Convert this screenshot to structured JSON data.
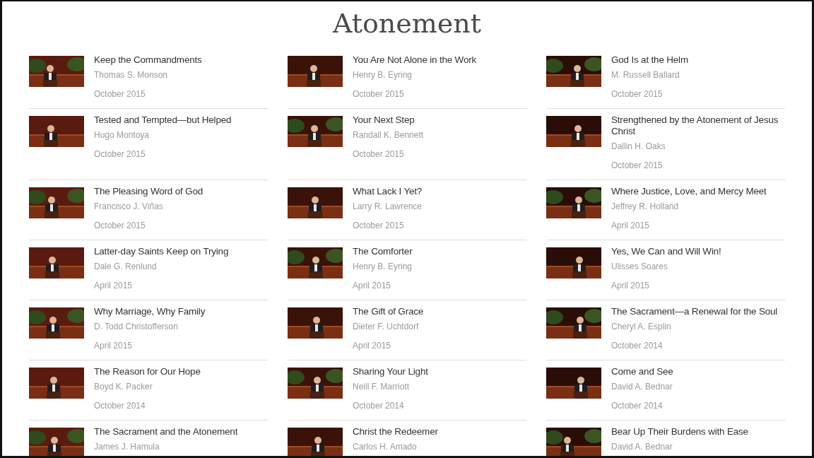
{
  "page": {
    "title": "Atonement"
  },
  "talks": [
    {
      "title": "Keep the Commandments",
      "speaker": "Thomas S. Monson",
      "date": "October 2015"
    },
    {
      "title": "You Are Not Alone in the Work",
      "speaker": "Henry B. Eyring",
      "date": "October 2015"
    },
    {
      "title": "God Is at the Helm",
      "speaker": "M. Russell Ballard",
      "date": "October 2015"
    },
    {
      "title": "Tested and Tempted—but Helped",
      "speaker": "Hugo Montoya",
      "date": "October 2015"
    },
    {
      "title": "Your Next Step",
      "speaker": "Randall K. Bennett",
      "date": "October 2015"
    },
    {
      "title": "Strengthened by the Atonement of Jesus Christ",
      "speaker": "Dallin H. Oaks",
      "date": "October 2015"
    },
    {
      "title": "The Pleasing Word of God",
      "speaker": "Francisco J. Viñas",
      "date": "October 2015"
    },
    {
      "title": "What Lack I Yet?",
      "speaker": "Larry R. Lawrence",
      "date": "October 2015"
    },
    {
      "title": "Where Justice, Love, and Mercy Meet",
      "speaker": "Jeffrey R. Holland",
      "date": "April 2015"
    },
    {
      "title": "Latter-day Saints Keep on Trying",
      "speaker": "Dale G. Renlund",
      "date": "April 2015"
    },
    {
      "title": "The Comforter",
      "speaker": "Henry B. Eyring",
      "date": "April 2015"
    },
    {
      "title": "Yes, We Can and Will Win!",
      "speaker": "Ulisses Soares",
      "date": "April 2015"
    },
    {
      "title": "Why Marriage, Why Family",
      "speaker": "D. Todd Christofferson",
      "date": "April 2015"
    },
    {
      "title": "The Gift of Grace",
      "speaker": "Dieter F. Uchtdorf",
      "date": "April 2015"
    },
    {
      "title": "The Sacrament—a Renewal for the Soul",
      "speaker": "Cheryl A. Esplin",
      "date": "October 2014"
    },
    {
      "title": "The Reason for Our Hope",
      "speaker": "Boyd K. Packer",
      "date": "October 2014"
    },
    {
      "title": "Sharing Your Light",
      "speaker": "Neill F. Marriott",
      "date": "October 2014"
    },
    {
      "title": "Come and See",
      "speaker": "David A. Bednar",
      "date": "October 2014"
    },
    {
      "title": "The Sacrament and the Atonement",
      "speaker": "James J. Hamula"
    },
    {
      "title": "Christ the Redeemer",
      "speaker": "Carlos H. Amado"
    },
    {
      "title": "Bear Up Their Burdens with Ease",
      "speaker": "David A. Bednar"
    }
  ]
}
